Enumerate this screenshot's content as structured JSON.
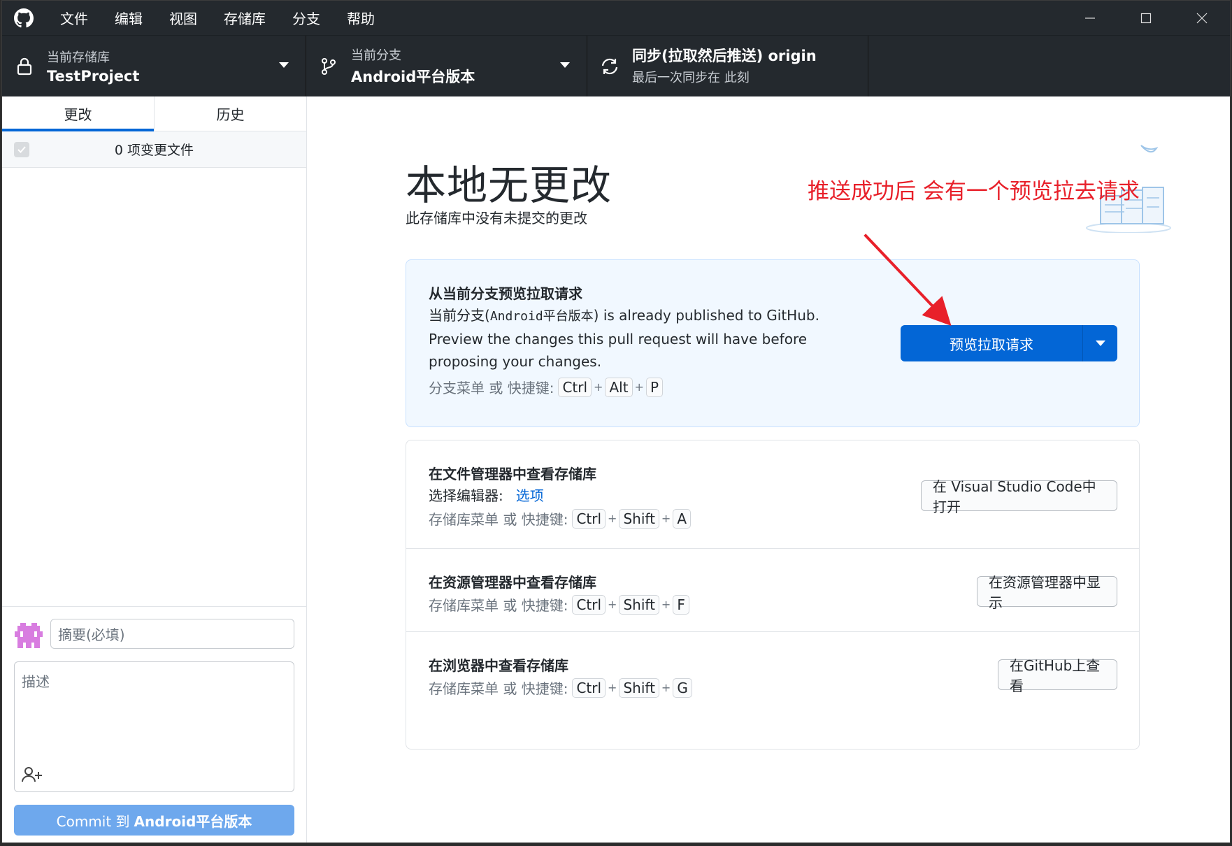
{
  "menu": [
    "文件",
    "编辑",
    "视图",
    "存储库",
    "分支",
    "帮助"
  ],
  "toolbar": {
    "repo_sub": "当前存储库",
    "repo_main": "TestProject",
    "branch_sub": "当前分支",
    "branch_main": "Android平台版本",
    "sync_main": "同步(拉取然后推送) origin",
    "sync_sub": "最后一次同步在 此刻"
  },
  "sidebar": {
    "tabs": [
      "更改",
      "历史"
    ],
    "changes_count": "0 项变更文件",
    "summary_placeholder": "摘要(必填)",
    "description_placeholder": "描述",
    "commit_prefix": "Commit 到",
    "commit_branch": "Android平台版本"
  },
  "main": {
    "headline": "本地无更改",
    "subline": "此存储库中没有未提交的更改",
    "annotation": "推送成功后 会有一个预览拉去请求",
    "pr_card": {
      "title": "从当前分支预览拉取请求",
      "text_prefix": "当前分支(",
      "branch": "Android平台版本",
      "text_suffix": ") is already published to GitHub.",
      "text_line2": "Preview the changes this pull request will have before",
      "text_line3": "proposing your changes.",
      "hint": "分支菜单 或 快捷键:",
      "keys": [
        "Ctrl",
        "Alt",
        "P"
      ],
      "button": "预览拉取请求"
    },
    "editor_row": {
      "title": "在文件管理器中查看存储库",
      "choose_label": "选择编辑器:",
      "options_link": "选项",
      "hint": "存储库菜单 或 快捷键:",
      "keys": [
        "Ctrl",
        "Shift",
        "A"
      ],
      "button": "在 Visual Studio Code中打开"
    },
    "explorer_row": {
      "title": "在资源管理器中查看存储库",
      "hint": "存储库菜单 或 快捷键:",
      "keys": [
        "Ctrl",
        "Shift",
        "F"
      ],
      "button": "在资源管理器中显示"
    },
    "browser_row": {
      "title": "在浏览器中查看存储库",
      "hint": "存储库菜单 或 快捷键:",
      "keys": [
        "Ctrl",
        "Shift",
        "G"
      ],
      "button": "在GitHub上查看"
    }
  },
  "colors": {
    "titlebar": "#24292e",
    "primary": "#0366d6",
    "commit_disabled": "#6ea8ed",
    "annotation": "#e8202a"
  },
  "icons": [
    "github-logo-icon",
    "minimize-icon",
    "maximize-icon",
    "close-icon",
    "lock-icon",
    "branch-icon",
    "sync-icon",
    "caret-down-icon",
    "checkbox-icon",
    "avatar-icon",
    "add-coauthor-icon"
  ]
}
